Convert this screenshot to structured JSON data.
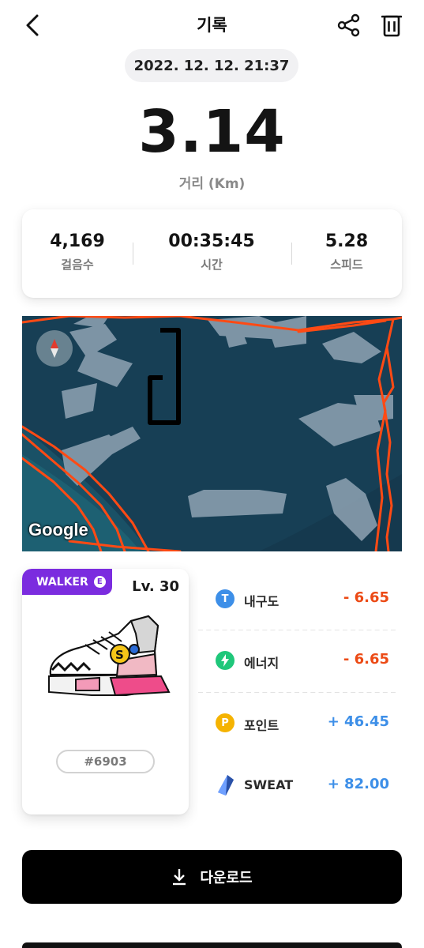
{
  "header": {
    "title": "기록"
  },
  "record": {
    "date": "2022. 12. 12. 21:37",
    "distance": "3.14",
    "distance_label": "거리 (Km)"
  },
  "stats": [
    {
      "value": "4,169",
      "label": "걸음수"
    },
    {
      "value": "00:35:45",
      "label": "시간"
    },
    {
      "value": "5.28",
      "label": "스피드"
    }
  ],
  "map": {
    "attribution": "Google",
    "background_color": "#173f55",
    "route_color": "#ff4a14"
  },
  "sneaker": {
    "type_label": "WALKER",
    "type_badge": "E",
    "level": "Lv. 30",
    "id": "#6903",
    "badge_color": "#7b2cdf"
  },
  "resources": [
    {
      "name": "내구도",
      "value": "- 6.65",
      "icon": "durability-icon",
      "icon_letter": "T",
      "icon_color": "#3d8fe8",
      "trend": "negative"
    },
    {
      "name": "에너지",
      "value": "- 6.65",
      "icon": "energy-icon",
      "icon_letter": "⚡",
      "icon_color": "#1fc77a",
      "trend": "negative"
    },
    {
      "name": "포인트",
      "value": "+ 46.45",
      "icon": "point-icon",
      "icon_letter": "P",
      "icon_color": "#f5b301",
      "trend": "positive"
    },
    {
      "name": "SWEAT",
      "value": "+ 82.00",
      "icon": "sweat-crystal-icon",
      "icon_letter": "",
      "icon_color": "#3b6fe0",
      "trend": "positive"
    }
  ],
  "actions": {
    "download_label": "다운로드"
  },
  "colors": {
    "negative": "#ec4a15",
    "positive": "#3d8fe8",
    "button": "#000000"
  }
}
